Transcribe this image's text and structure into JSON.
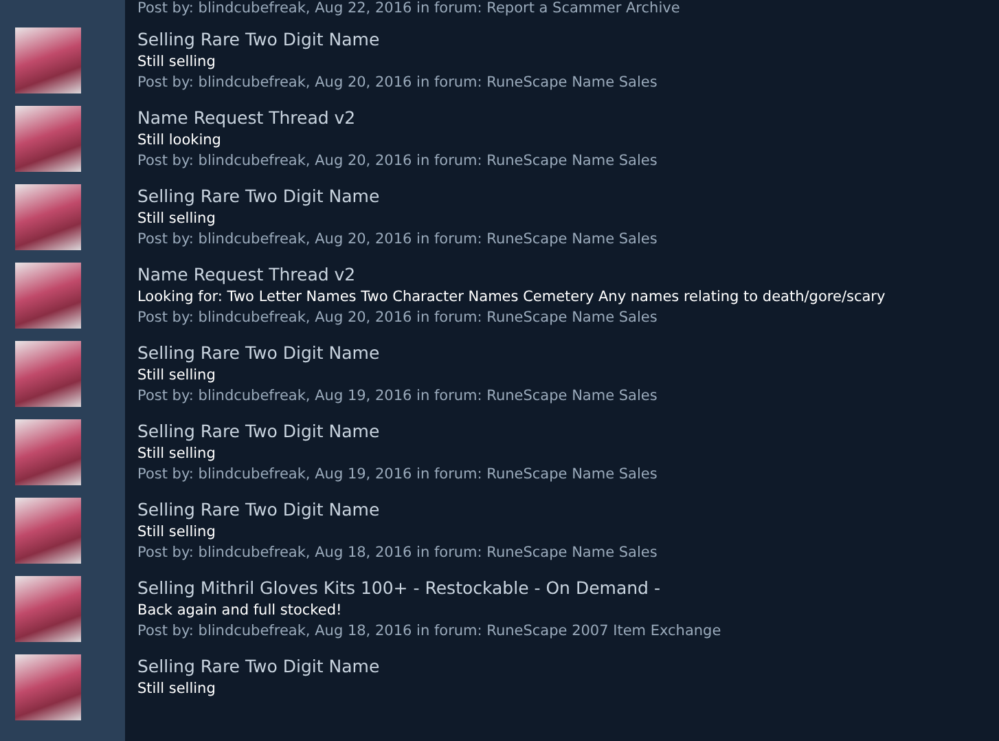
{
  "top_meta": "Post by: blindcubefreak, Aug 22, 2016 in forum: Report a Scammer Archive",
  "posts": [
    {
      "title": "Selling Rare Two Digit Name",
      "body": "Still selling",
      "meta": "Post by: blindcubefreak, Aug 20, 2016 in forum: RuneScape Name Sales"
    },
    {
      "title": "Name Request Thread v2",
      "body": "Still looking",
      "meta": "Post by: blindcubefreak, Aug 20, 2016 in forum: RuneScape Name Sales"
    },
    {
      "title": "Selling Rare Two Digit Name",
      "body": "Still selling",
      "meta": "Post by: blindcubefreak, Aug 20, 2016 in forum: RuneScape Name Sales"
    },
    {
      "title": "Name Request Thread v2",
      "body": "Looking for: Two Letter Names Two Character Names Cemetery Any names relating to death/gore/scary",
      "meta": "Post by: blindcubefreak, Aug 20, 2016 in forum: RuneScape Name Sales"
    },
    {
      "title": "Selling Rare Two Digit Name",
      "body": "Still selling",
      "meta": "Post by: blindcubefreak, Aug 19, 2016 in forum: RuneScape Name Sales"
    },
    {
      "title": "Selling Rare Two Digit Name",
      "body": "Still selling",
      "meta": "Post by: blindcubefreak, Aug 19, 2016 in forum: RuneScape Name Sales"
    },
    {
      "title": "Selling Rare Two Digit Name",
      "body": "Still selling",
      "meta": "Post by: blindcubefreak, Aug 18, 2016 in forum: RuneScape Name Sales"
    },
    {
      "title": "Selling Mithril Gloves Kits 100+ - Restockable - On Demand -",
      "body": "Back again and full stocked!",
      "meta": "Post by: blindcubefreak, Aug 18, 2016 in forum: RuneScape 2007 Item Exchange"
    },
    {
      "title": "Selling Rare Two Digit Name",
      "body": "Still selling"
    }
  ]
}
